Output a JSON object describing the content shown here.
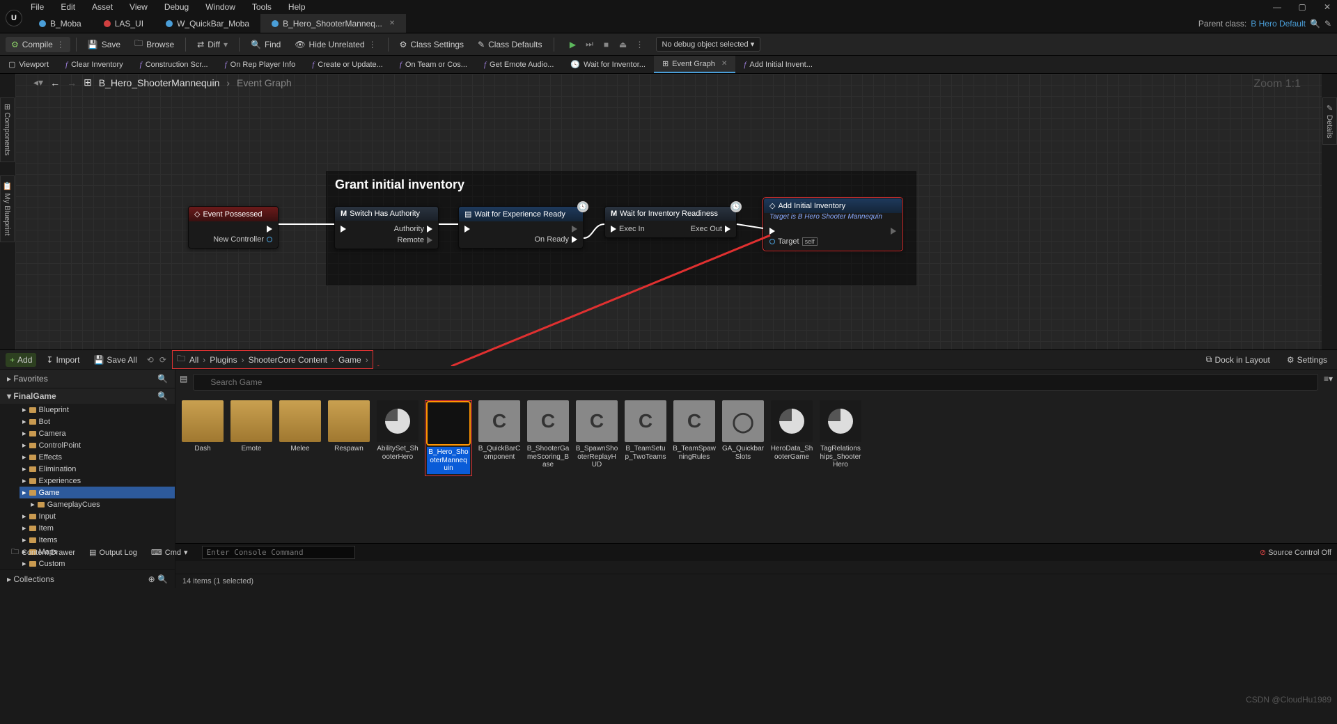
{
  "menubar": [
    "File",
    "Edit",
    "Asset",
    "View",
    "Debug",
    "Window",
    "Tools",
    "Help"
  ],
  "windowButtons": {
    "min": "—",
    "max": "▢",
    "close": "✕"
  },
  "docTabs": [
    {
      "label": "B_Moba",
      "color": "#4a9ed8"
    },
    {
      "label": "LAS_UI",
      "color": "#d04040"
    },
    {
      "label": "W_QuickBar_Moba",
      "color": "#4a9ed8"
    },
    {
      "label": "B_Hero_ShooterManneq...",
      "color": "#4a9ed8",
      "active": true,
      "closable": true
    }
  ],
  "parentClass": {
    "prefix": "Parent class:",
    "link": "B Hero Default"
  },
  "toolbar": {
    "compile": "Compile",
    "save": "Save",
    "browse": "Browse",
    "diff": "Diff",
    "find": "Find",
    "hide": "Hide Unrelated",
    "classSettings": "Class Settings",
    "classDefaults": "Class Defaults",
    "debugSelect": "No debug object selected"
  },
  "fnTabs": [
    {
      "icon": "vp",
      "label": "Viewport"
    },
    {
      "icon": "f",
      "label": "Clear Inventory"
    },
    {
      "icon": "f",
      "label": "Construction Scr..."
    },
    {
      "icon": "f",
      "label": "On Rep Player Info"
    },
    {
      "icon": "f",
      "label": "Create or Update..."
    },
    {
      "icon": "f",
      "label": "On Team or Cos..."
    },
    {
      "icon": "f",
      "label": "Get Emote Audio..."
    },
    {
      "icon": "clock",
      "label": "Wait for Inventor..."
    },
    {
      "icon": "graph",
      "label": "Event Graph",
      "active": true,
      "closable": true
    },
    {
      "icon": "f",
      "label": "Add Initial Invent..."
    }
  ],
  "sideTabs": {
    "components": "Components",
    "myBlueprint": "My Blueprint",
    "details": "Details"
  },
  "breadcrumb": {
    "asset": "B_Hero_ShooterMannequin",
    "graph": "Event Graph"
  },
  "zoom": "Zoom 1:1",
  "graph": {
    "commentTitle": "Grant initial inventory",
    "nodes": {
      "event": {
        "title": "Event Possessed",
        "pin": "New Controller"
      },
      "switch": {
        "title": "Switch Has Authority",
        "out1": "Authority",
        "out2": "Remote"
      },
      "wait1": {
        "title": "Wait for Experience Ready",
        "out": "On Ready"
      },
      "wait2": {
        "title": "Wait for Inventory Readiness",
        "in": "Exec In",
        "out": "Exec Out"
      },
      "add": {
        "title": "Add Initial Inventory",
        "sub": "Target is B Hero Shooter Mannequin",
        "target": "Target",
        "self": "self"
      }
    }
  },
  "contentBrowser": {
    "add": "Add",
    "import": "Import",
    "saveAll": "Save All",
    "pathParts": [
      "All",
      "Plugins",
      "ShooterCore Content",
      "Game"
    ],
    "dock": "Dock in Layout",
    "settings": "Settings",
    "searchPlaceholder": "Search Game",
    "favorites": "Favorites",
    "root": "FinalGame",
    "collections": "Collections",
    "tree": [
      "Blueprint",
      "Bot",
      "Camera",
      "ControlPoint",
      "Effects",
      "Elimination",
      "Experiences",
      "Game",
      "GameplayCues",
      "Input",
      "Item",
      "Items",
      "Maps",
      "Custom"
    ],
    "treeSelected": "Game",
    "folders": [
      "Dash",
      "Emote",
      "Melee",
      "Respawn"
    ],
    "assets": [
      {
        "label": "AbilitySet_ShooterHero",
        "type": "data"
      },
      {
        "label": "B_Hero_ShooterMannequin",
        "type": "bp",
        "selected": true
      },
      {
        "label": "B_QuickBarComponent",
        "type": "class"
      },
      {
        "label": "B_ShooterGameScoring_Base",
        "type": "class"
      },
      {
        "label": "B_SpawnShooterReplayHUD",
        "type": "class"
      },
      {
        "label": "B_TeamSetup_TwoTeams",
        "type": "class"
      },
      {
        "label": "B_TeamSpawningRules",
        "type": "class"
      },
      {
        "label": "GA_QuickbarSlots",
        "type": "sphere"
      },
      {
        "label": "HeroData_ShooterGame",
        "type": "data"
      },
      {
        "label": "TagRelationships_ShooterHero",
        "type": "data"
      }
    ],
    "status": "14 items (1 selected)"
  },
  "bottomBar": {
    "drawer": "Content Drawer",
    "output": "Output Log",
    "cmdLabel": "Cmd",
    "cmdPlaceholder": "Enter Console Command",
    "sourceControl": "Source Control Off"
  },
  "watermark": "CSDN @CloudHu1989"
}
